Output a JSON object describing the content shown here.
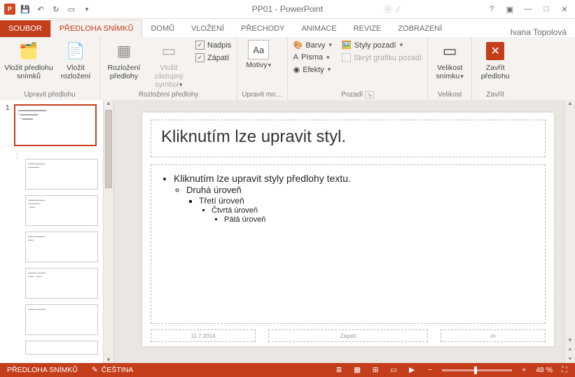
{
  "titlebar": {
    "title": "PP01 - PowerPoint"
  },
  "tabs": {
    "file": "SOUBOR",
    "items": [
      "PŘEDLOHA SNÍMKŮ",
      "DOMŮ",
      "VLOŽENÍ",
      "PŘECHODY",
      "ANIMACE",
      "REVIZE",
      "ZOBRAZENÍ"
    ],
    "activeIndex": 0,
    "user": "Ivana Topolová"
  },
  "ribbon": {
    "g1": {
      "label": "Upravit předlohu",
      "b1": "Vložit předlohu snímků",
      "b2": "Vložit rozložení"
    },
    "g2": {
      "label": "Rozložení předlohy",
      "b1": "Rozložení předlohy",
      "b2": "Vložit zástupný symbol"
    },
    "g3": {
      "nadpis": "Nadpis",
      "zapati": "Zápatí"
    },
    "g4": {
      "label": "Upravit mo…",
      "b1": "Motivy"
    },
    "g5": {
      "label": "Pozadí",
      "barvy": "Barvy",
      "pisma": "Písma",
      "efekty": "Efekty",
      "styly": "Styly pozadí",
      "skryt": "Skrýt grafiku pozadí"
    },
    "g6": {
      "label": "Velikost",
      "b1": "Velikost snímku"
    },
    "g7": {
      "label": "Zavřít",
      "b1": "Zavřít předlohu"
    }
  },
  "thumbs": {
    "num": "1"
  },
  "slide": {
    "title": "Kliknutím lze upravit styl.",
    "b1": "Kliknutím lze upravit styly předlohy textu.",
    "b2": "Druhá úroveň",
    "b3": "Třetí úroveň",
    "b4": "Čtvrtá úroveň",
    "b5": "Pátá úroveň",
    "footDate": "11.7.2014",
    "footCenter": "Zápatí",
    "footNum": "‹#›"
  },
  "status": {
    "mode": "PŘEDLOHA SNÍMKŮ",
    "lang": "ČEŠTINA",
    "zoom": "48 %"
  }
}
